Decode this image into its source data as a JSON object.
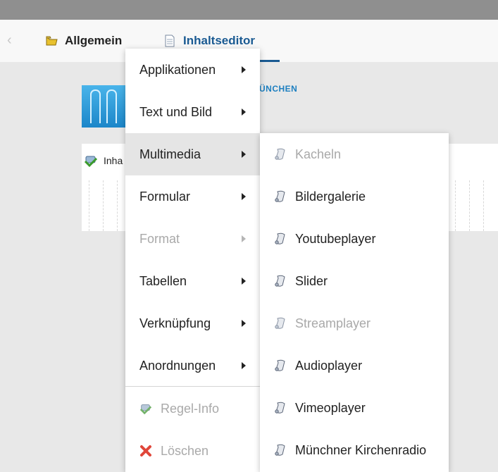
{
  "tabs": [
    {
      "label": "Allgemein",
      "icon": "folder-icon"
    },
    {
      "label": "Inhaltseditor",
      "icon": "document-icon"
    }
  ],
  "page": {
    "logo_text": "ÜNCHEN",
    "panel_label": "Inha"
  },
  "main_menu": {
    "items": [
      {
        "label": "Applikationen",
        "submenu": true,
        "disabled": false
      },
      {
        "label": "Text und Bild",
        "submenu": true,
        "disabled": false
      },
      {
        "label": "Multimedia",
        "submenu": true,
        "disabled": false,
        "active": true
      },
      {
        "label": "Formular",
        "submenu": true,
        "disabled": false
      },
      {
        "label": "Format",
        "submenu": true,
        "disabled": true
      },
      {
        "label": "Tabellen",
        "submenu": true,
        "disabled": false
      },
      {
        "label": "Verknüpfung",
        "submenu": true,
        "disabled": false
      },
      {
        "label": "Anordnungen",
        "submenu": true,
        "disabled": false
      }
    ],
    "actions": [
      {
        "label": "Regel-Info",
        "icon": "rule-info-icon",
        "disabled": true
      },
      {
        "label": "Löschen",
        "icon": "delete-icon",
        "disabled": true
      }
    ]
  },
  "sub_menu": {
    "items": [
      {
        "label": "Kacheln",
        "icon": "scroll-icon",
        "disabled": true
      },
      {
        "label": "Bildergalerie",
        "icon": "scroll-icon",
        "disabled": false
      },
      {
        "label": "Youtubeplayer",
        "icon": "scroll-icon",
        "disabled": false
      },
      {
        "label": "Slider",
        "icon": "scroll-icon",
        "disabled": false
      },
      {
        "label": "Streamplayer",
        "icon": "scroll-icon",
        "disabled": true
      },
      {
        "label": "Audioplayer",
        "icon": "scroll-icon",
        "disabled": false
      },
      {
        "label": "Vimeoplayer",
        "icon": "scroll-icon",
        "disabled": false
      },
      {
        "label": "Münchner Kirchenradio",
        "icon": "scroll-icon",
        "disabled": false
      }
    ]
  },
  "colors": {
    "accent": "#1a5a92",
    "menu_hover": "#e5e5e5",
    "disabled_text": "#a9a9a9"
  }
}
